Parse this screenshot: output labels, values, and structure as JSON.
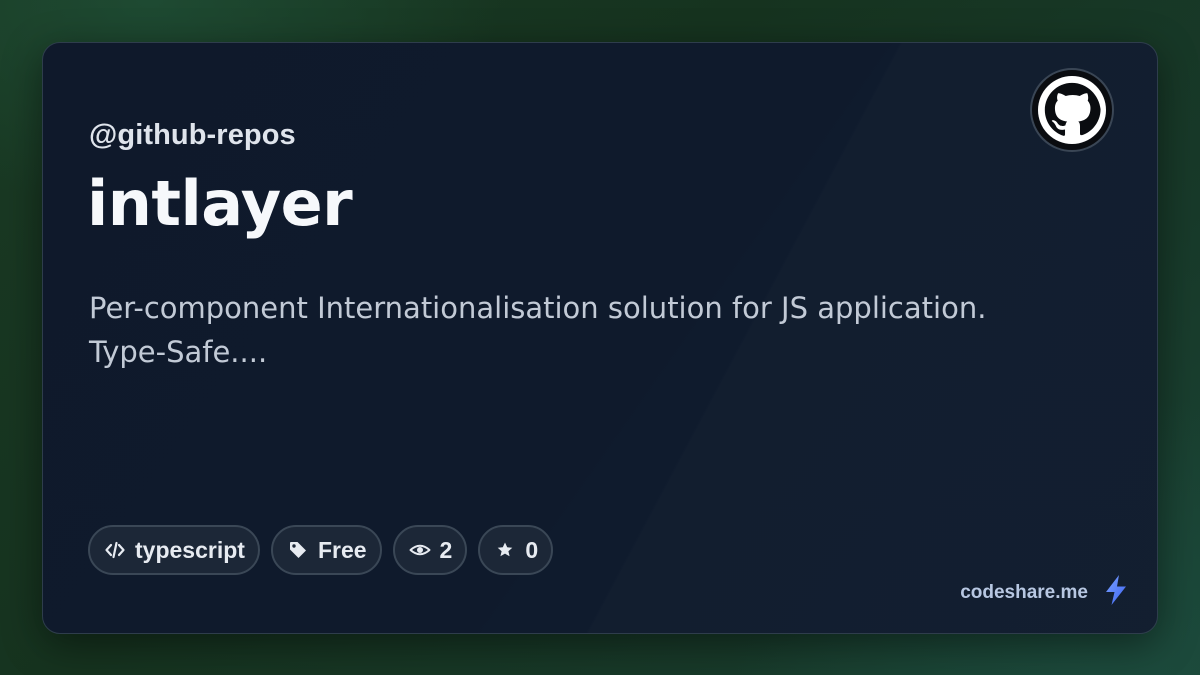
{
  "card": {
    "owner": "@github-repos",
    "title": "intlayer",
    "description_line1": "Per-component Internationalisation solution for JS application.",
    "description_line2": "Type-Safe....",
    "avatar_icon": "github-octocat-icon"
  },
  "badges": [
    {
      "icon": "code-icon",
      "label": "typescript"
    },
    {
      "icon": "tag-icon",
      "label": "Free"
    },
    {
      "icon": "eye-icon",
      "label": "2"
    },
    {
      "icon": "star-icon",
      "label": "0"
    }
  ],
  "brand": {
    "label": "codeshare.me",
    "icon": "lightning-bolt-icon",
    "accent_color": "#4f7dfc"
  },
  "colors": {
    "card_background": "#0f192b",
    "badge_background": "#1c2737",
    "page_background": "#16331f"
  }
}
